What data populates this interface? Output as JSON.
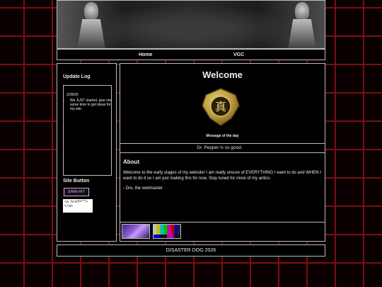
{
  "nav": {
    "home": "Home",
    "vgc": "VGC"
  },
  "sidebar": {
    "update_log_title": "Update Log",
    "update_date": "2/28/26",
    "updates": [
      "We JUST started, give me some time to get ideas for my site."
    ],
    "site_button_title": "Site Button",
    "site_button_text": "SHIN-HIT",
    "code_snippet": "<a href=\"\">\n</a>"
  },
  "main": {
    "welcome_title": "Welcome",
    "emblem_kanji": "真",
    "motd_label": "Message of the day",
    "motd": "Dr. Pepper is so good.",
    "about_title": "About",
    "about_paragraphs": [
      "Welcome to the early stages of my website! I am really unsure of EVERYTHING I want to do and WHEN I want to do it so I am just making this for now. Stay tuned for more of my antics.",
      "- Dre, the webmaster"
    ]
  },
  "footer": {
    "text": "DISASTER DOG 2026"
  },
  "colors": {
    "grid_lines": "#7a0e12",
    "background": "#0a0000",
    "panel": "#000000",
    "border": "#bbbbbb",
    "emblem_gold": "#b8963a"
  }
}
